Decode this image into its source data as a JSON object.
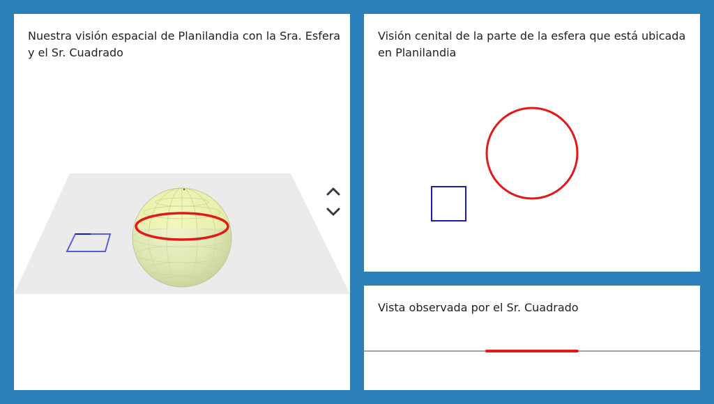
{
  "panels": {
    "space_view": {
      "title": "Nuestra visión espacial de Planilandia con la Sra. Esfera y el Sr. Cuadrado",
      "controls": {
        "up_icon": "chevron-up-icon",
        "down_icon": "chevron-down-icon"
      }
    },
    "top_view": {
      "title": "Visión cenital de la parte de la esfera que está ubicada en Planilandia"
    },
    "observed_view": {
      "title": "Vista observada por el Sr. Cuadrado"
    }
  },
  "colors": {
    "background": "#2a80b9",
    "plane": "#ebebeb",
    "sphere": "#e4ecb8",
    "sphere_cap": "#eef4a8",
    "section": "#e31818",
    "square": "#1a1aa8",
    "square_3d": "#5555dd",
    "horizon": "#888888"
  }
}
